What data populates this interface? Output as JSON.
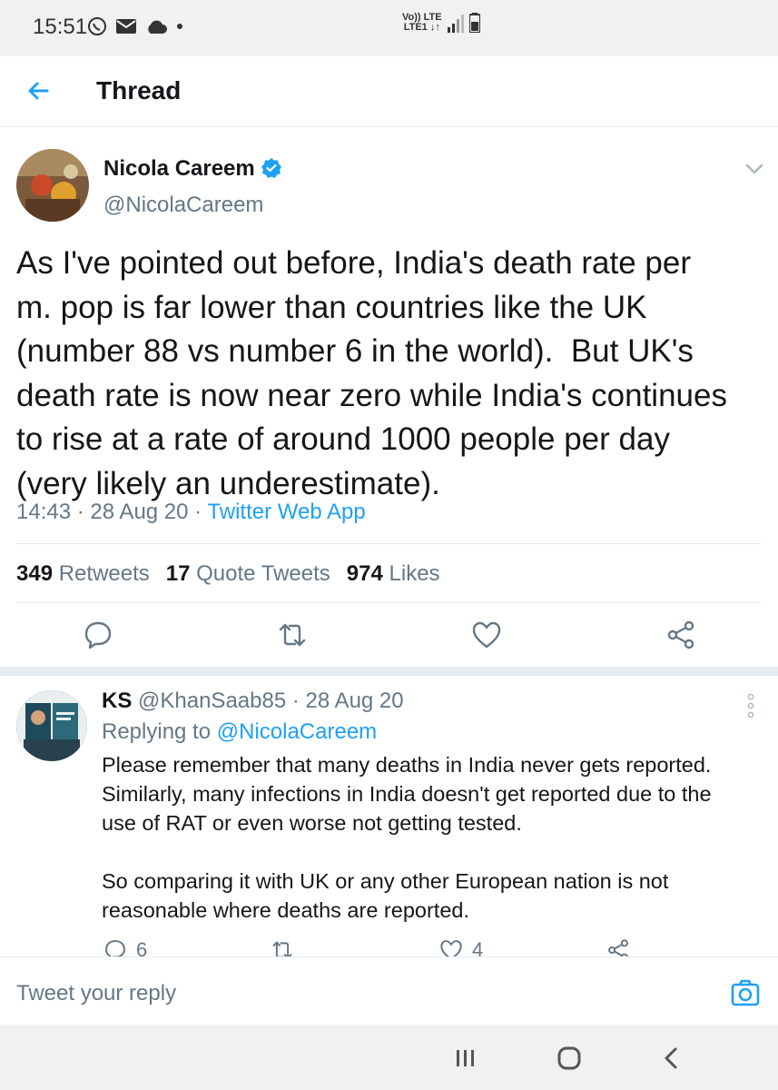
{
  "status_bar": {
    "time": "15:51",
    "network_top": "Vo)) LTE",
    "network_bottom": "LTE1 ↓↑"
  },
  "header": {
    "title": "Thread"
  },
  "tweet": {
    "author_name": "Nicola Careem",
    "handle": "@NicolaCareem",
    "text_lines": [
      "As I've pointed out before, India's death rate per",
      "m. pop is far lower than countries like the UK",
      "(number 88 vs number 6 in the world).  But UK's",
      "death rate is now near zero while India's continues",
      "to rise at a rate of around 1000 people per day",
      "(very likely an underestimate)."
    ],
    "time": "14:43",
    "date": "28 Aug 20",
    "source": "Twitter Web App",
    "retweets_count": "349",
    "retweets_label": "Retweets",
    "quotes_count": "17",
    "quotes_label": "Quote Tweets",
    "likes_count": "974",
    "likes_label": "Likes"
  },
  "reply": {
    "name": "KS",
    "handle": "@KhanSaab85",
    "date": "28 Aug 20",
    "replying_label": "Replying to",
    "replying_to": "@NicolaCareem",
    "text_lines_1": [
      "Please remember that many deaths in India never gets reported.",
      "Similarly, many infections in India doesn't get reported due to the",
      "use of RAT or even worse not getting tested."
    ],
    "text_lines_2": [
      "So comparing it with UK or any other European nation is not",
      "reasonable where deaths are reported."
    ],
    "reply_count": "6",
    "like_count": "4"
  },
  "compose": {
    "placeholder": "Tweet your reply"
  },
  "colors": {
    "accent": "#1da1f2",
    "muted": "#657786",
    "text": "#14171a"
  },
  "icons": [
    "back-arrow-icon",
    "verified-badge-icon",
    "chevron-down-icon",
    "reply-icon",
    "retweet-icon",
    "like-icon",
    "share-icon",
    "more-vertical-icon",
    "camera-icon"
  ]
}
